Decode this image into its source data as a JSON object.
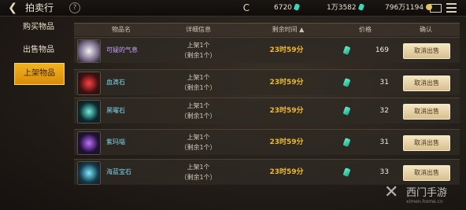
{
  "header": {
    "back_icon": "back-arrow-icon",
    "title": "拍卖行",
    "help": "?",
    "currency_c": "C",
    "currencies": [
      {
        "value": "6720",
        "icon": "gem-icon"
      },
      {
        "value": "1万3582",
        "icon": "gem-icon"
      },
      {
        "value": "796万1194",
        "icon": "coin-icon"
      }
    ]
  },
  "sidebar": {
    "items": [
      {
        "label": "购买物品",
        "active": false
      },
      {
        "label": "出售物品",
        "active": false
      },
      {
        "label": "上架物品",
        "active": true
      }
    ]
  },
  "table": {
    "headers": {
      "name": "物品名",
      "detail": "详细信息",
      "time": "剩余时间 ▲",
      "price": "价格",
      "confirm": "确认"
    },
    "rows": [
      {
        "name": "可疑的气息",
        "name_color": "#c9a0ff",
        "icon_colors": [
          "#f0f0f0",
          "#7a6a8a"
        ],
        "detail_1": "上架1个",
        "detail_2": "（剩余1个）",
        "time": "23时59分",
        "price": "169",
        "action": "取消出售"
      },
      {
        "name": "血滴石",
        "name_color": "#7fd7f0",
        "icon_colors": [
          "#ff4040",
          "#401010"
        ],
        "detail_1": "上架1个",
        "detail_2": "（剩余1个）",
        "time": "23时59分",
        "price": "31",
        "action": "取消出售"
      },
      {
        "name": "黑曜石",
        "name_color": "#7fd7f0",
        "icon_colors": [
          "#6ff0e0",
          "#0a2a30"
        ],
        "detail_1": "上架1个",
        "detail_2": "（剩余1个）",
        "time": "23时59分",
        "price": "32",
        "action": "取消出售"
      },
      {
        "name": "紫玛瑙",
        "name_color": "#7fd7f0",
        "icon_colors": [
          "#c070ff",
          "#20103a"
        ],
        "detail_1": "上架1个",
        "detail_2": "（剩余1个）",
        "time": "23时59分",
        "price": "31",
        "action": "取消出售"
      },
      {
        "name": "海蓝宝石",
        "name_color": "#7fd7f0",
        "icon_colors": [
          "#80e8ff",
          "#103a4a"
        ],
        "detail_1": "上架1个",
        "detail_2": "（剩余1个）",
        "time": "23时59分",
        "price": "33",
        "action": "取消出售"
      }
    ]
  },
  "watermark": {
    "brand": "西门手游",
    "site": "ximen-home.cn"
  }
}
